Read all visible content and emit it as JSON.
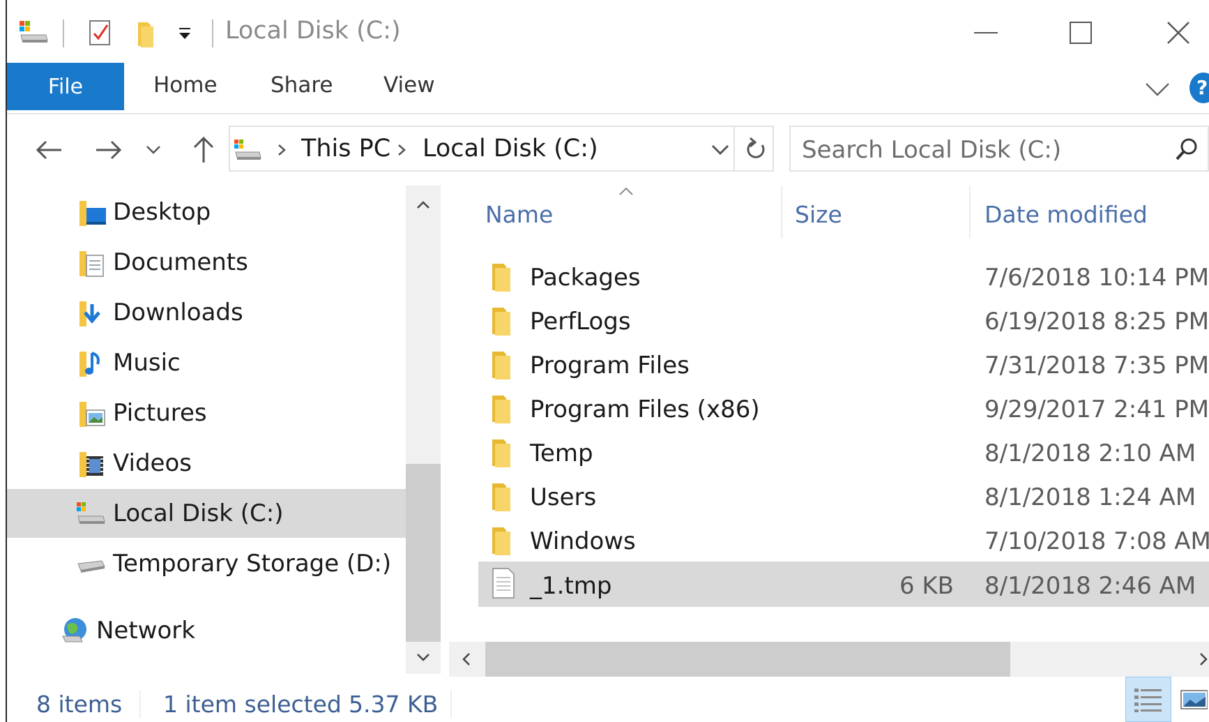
{
  "window": {
    "title": "Local Disk (C:)",
    "controls": {
      "minimize": "minimize-icon",
      "maximize": "maximize-icon",
      "close": "close-icon"
    }
  },
  "ribbon": {
    "tabs": [
      {
        "label": "File",
        "active": true
      },
      {
        "label": "Home"
      },
      {
        "label": "Share"
      },
      {
        "label": "View"
      }
    ],
    "help": "?"
  },
  "address": {
    "crumbs": [
      "This PC",
      "Local Disk (C:)"
    ]
  },
  "search": {
    "placeholder": "Search Local Disk (C:)"
  },
  "nav_pane": {
    "items": [
      {
        "label": "Desktop",
        "icon": "desktop-folder-icon"
      },
      {
        "label": "Documents",
        "icon": "documents-folder-icon"
      },
      {
        "label": "Downloads",
        "icon": "downloads-folder-icon"
      },
      {
        "label": "Music",
        "icon": "music-folder-icon"
      },
      {
        "label": "Pictures",
        "icon": "pictures-folder-icon"
      },
      {
        "label": "Videos",
        "icon": "videos-folder-icon"
      },
      {
        "label": "Local Disk (C:)",
        "icon": "local-disk-icon",
        "selected": true
      },
      {
        "label": "Temporary Storage (D:)",
        "icon": "drive-icon"
      },
      {
        "label": "Network",
        "icon": "network-icon"
      }
    ]
  },
  "columns": {
    "name": "Name",
    "size": "Size",
    "date": "Date modified"
  },
  "files": [
    {
      "name": "Packages",
      "size": "",
      "date": "7/6/2018 10:14 PM",
      "type": "folder"
    },
    {
      "name": "PerfLogs",
      "size": "",
      "date": "6/19/2018 8:25 PM",
      "type": "folder"
    },
    {
      "name": "Program Files",
      "size": "",
      "date": "7/31/2018 7:35 PM",
      "type": "folder"
    },
    {
      "name": "Program Files (x86)",
      "size": "",
      "date": "9/29/2017 2:41 PM",
      "type": "folder"
    },
    {
      "name": "Temp",
      "size": "",
      "date": "8/1/2018 2:10 AM",
      "type": "folder"
    },
    {
      "name": "Users",
      "size": "",
      "date": "8/1/2018 1:24 AM",
      "type": "folder"
    },
    {
      "name": "Windows",
      "size": "",
      "date": "7/10/2018 7:08 AM",
      "type": "folder"
    },
    {
      "name": "_1.tmp",
      "size": "6 KB",
      "date": "8/1/2018 2:46 AM",
      "type": "file",
      "selected": true
    }
  ],
  "status": {
    "item_count": "8 items",
    "selected": "1 item selected",
    "selected_size": "5.37 KB"
  },
  "colors": {
    "accent": "#1979ca",
    "selection": "#d9d9d9",
    "header_text": "#4a6ea8",
    "folder": "#f4c542"
  }
}
